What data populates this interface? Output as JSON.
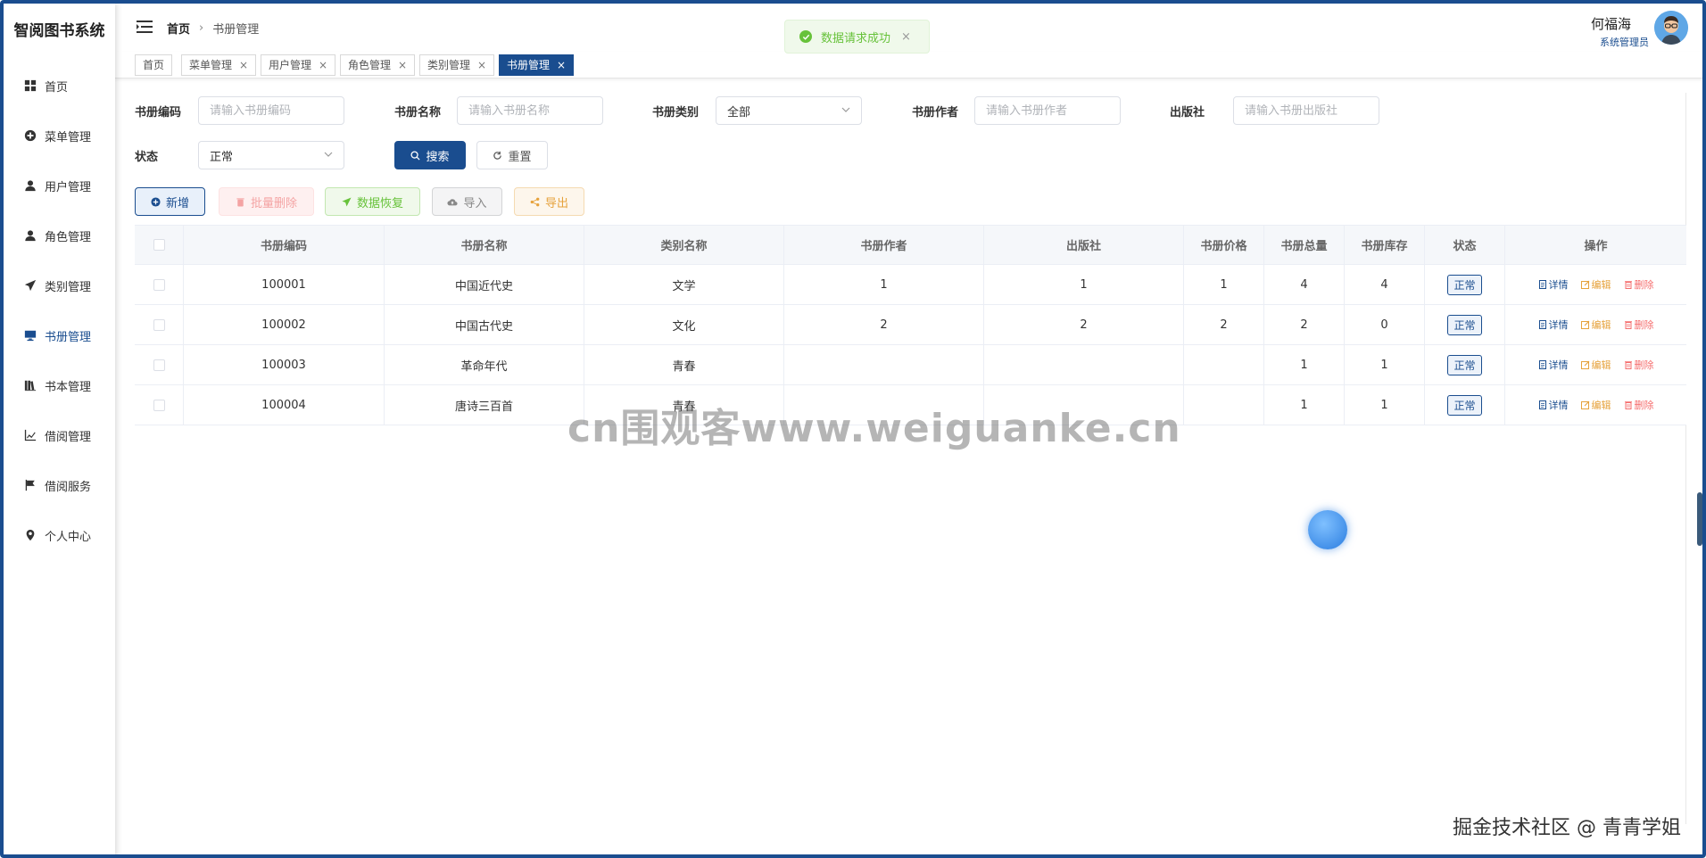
{
  "app": {
    "title": "智阅图书系统"
  },
  "sidebar": {
    "items": [
      {
        "label": "首页",
        "icon": "grid-icon"
      },
      {
        "label": "菜单管理",
        "icon": "plus-circle-icon"
      },
      {
        "label": "用户管理",
        "icon": "user-icon"
      },
      {
        "label": "角色管理",
        "icon": "user-role-icon"
      },
      {
        "label": "类别管理",
        "icon": "send-icon"
      },
      {
        "label": "书册管理",
        "icon": "monitor-icon",
        "active": true
      },
      {
        "label": "书本管理",
        "icon": "books-icon"
      },
      {
        "label": "借阅管理",
        "icon": "chart-icon"
      },
      {
        "label": "借阅服务",
        "icon": "flag-icon"
      },
      {
        "label": "个人中心",
        "icon": "location-icon"
      }
    ]
  },
  "header": {
    "breadcrumb_home": "首页",
    "breadcrumb_current": "书册管理",
    "user_name": "何福海",
    "user_role": "系统管理员"
  },
  "tabs": [
    {
      "label": "首页"
    },
    {
      "label": "菜单管理"
    },
    {
      "label": "用户管理"
    },
    {
      "label": "角色管理"
    },
    {
      "label": "类别管理"
    },
    {
      "label": "书册管理",
      "active": true
    }
  ],
  "toast": {
    "message": "数据请求成功"
  },
  "filters": {
    "code_label": "书册编码",
    "code_placeholder": "请输入书册编码",
    "name_label": "书册名称",
    "name_placeholder": "请输入书册名称",
    "category_label": "书册类别",
    "category_value": "全部",
    "author_label": "书册作者",
    "author_placeholder": "请输入书册作者",
    "publisher_label": "出版社",
    "publisher_placeholder": "请输入书册出版社",
    "status_label": "状态",
    "status_value": "正常",
    "search_label": "搜索",
    "reset_label": "重置"
  },
  "toolbar": {
    "add_label": "新增",
    "batch_delete_label": "批量删除",
    "restore_label": "数据恢复",
    "import_label": "导入",
    "export_label": "导出"
  },
  "table": {
    "headers": [
      "书册编码",
      "书册名称",
      "类别名称",
      "书册作者",
      "出版社",
      "书册价格",
      "书册总量",
      "书册库存",
      "状态",
      "操作"
    ],
    "rows": [
      {
        "code": "100001",
        "name": "中国近代史",
        "category": "文学",
        "author": "1",
        "publisher": "1",
        "price": "1",
        "total": "4",
        "stock": "4",
        "status": "正常"
      },
      {
        "code": "100002",
        "name": "中国古代史",
        "category": "文化",
        "author": "2",
        "publisher": "2",
        "price": "2",
        "total": "2",
        "stock": "0",
        "status": "正常"
      },
      {
        "code": "100003",
        "name": "革命年代",
        "category": "青春",
        "author": "",
        "publisher": "",
        "price": "",
        "total": "1",
        "stock": "1",
        "status": "正常"
      },
      {
        "code": "100004",
        "name": "唐诗三百首",
        "category": "青春",
        "author": "",
        "publisher": "",
        "price": "",
        "total": "1",
        "stock": "1",
        "status": "正常"
      }
    ],
    "op_detail": "详情",
    "op_edit": "编辑",
    "op_delete": "删除"
  },
  "watermark": {
    "text": "cn围观客www.weiguanke.cn"
  },
  "footer": {
    "community": "掘金技术社区 @ 青青学姐"
  },
  "colors": {
    "primary": "#1a4d8f",
    "success": "#67c23a",
    "warning": "#e6a23c",
    "danger": "#f56c6c"
  }
}
